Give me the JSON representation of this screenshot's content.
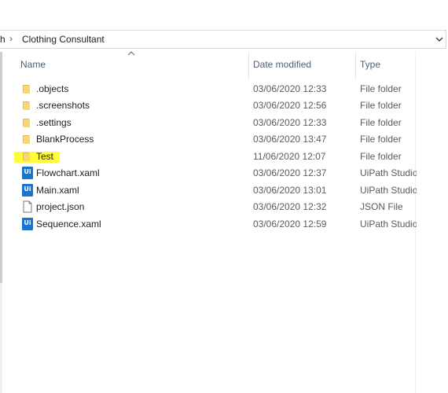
{
  "address_bar": {
    "cut_segment": "h",
    "current_folder": "Clothing Consultant"
  },
  "columns": {
    "name": "Name",
    "date_modified": "Date modified",
    "type": "Type"
  },
  "files": [
    {
      "name": ".objects",
      "date": "03/06/2020 12:33",
      "type": "File folder",
      "icon": "folder-icon"
    },
    {
      "name": ".screenshots",
      "date": "03/06/2020 12:56",
      "type": "File folder",
      "icon": "folder-icon"
    },
    {
      "name": ".settings",
      "date": "03/06/2020 12:33",
      "type": "File folder",
      "icon": "folder-icon"
    },
    {
      "name": "BlankProcess",
      "date": "03/06/2020 13:47",
      "type": "File folder",
      "icon": "folder-icon"
    },
    {
      "name": "Test",
      "date": "11/06/2020 12:07",
      "type": "File folder",
      "icon": "folder-icon",
      "highlighted": true
    },
    {
      "name": "Flowchart.xaml",
      "date": "03/06/2020 12:37",
      "type": "UiPath Studio",
      "icon": "uipath-file-icon"
    },
    {
      "name": "Main.xaml",
      "date": "03/06/2020 13:01",
      "type": "UiPath Studio",
      "icon": "uipath-file-icon"
    },
    {
      "name": "project.json",
      "date": "03/06/2020 12:32",
      "type": "JSON File",
      "icon": "document-icon"
    },
    {
      "name": "Sequence.xaml",
      "date": "03/06/2020 12:59",
      "type": "UiPath Studio",
      "icon": "uipath-file-icon"
    }
  ],
  "icon_text": {
    "uipath": "Ui"
  },
  "colors": {
    "folder": "#f8d775",
    "uipath": "#1a74d2",
    "highlight": "#fffd38",
    "header_text": "#4c607a"
  }
}
